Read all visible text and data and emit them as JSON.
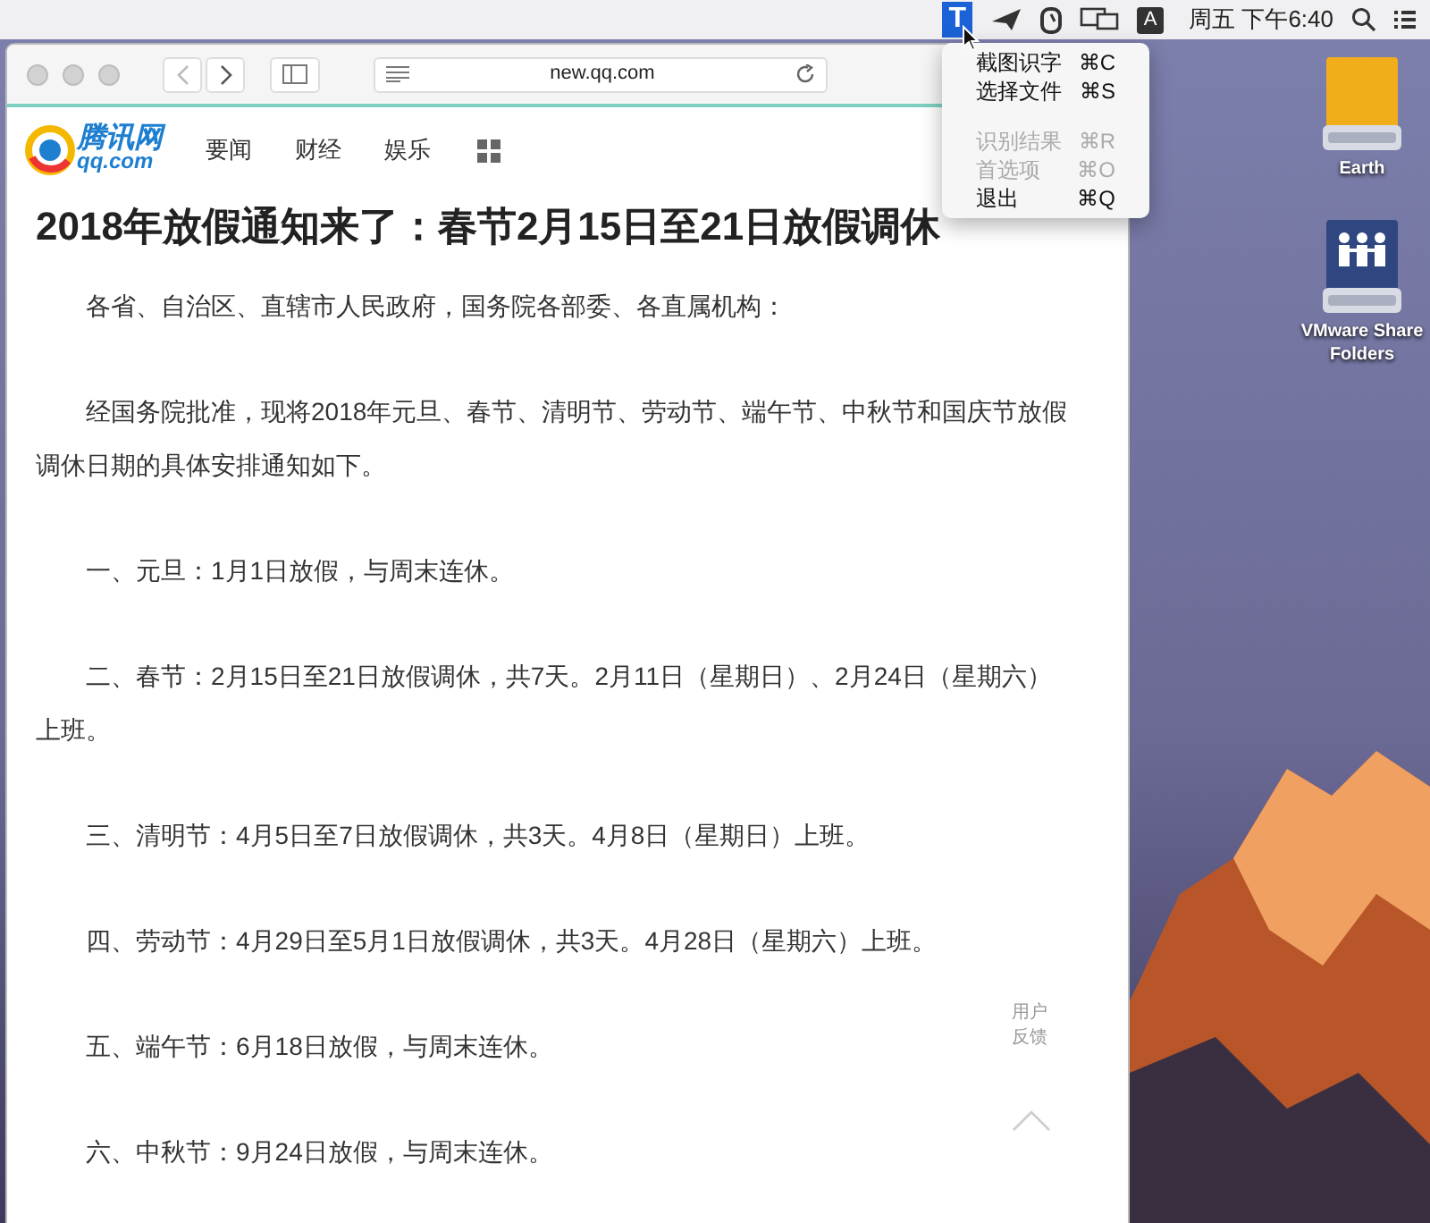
{
  "menu_bar": {
    "clock": "周五 下午6:40",
    "app_icon": {
      "glyph": "T",
      "selected": true
    },
    "input_icon": "A"
  },
  "dropdown_menu": {
    "groups": [
      [
        {
          "label": "截图识字",
          "shortcut": "⌘C",
          "disabled": false
        },
        {
          "label": "选择文件",
          "shortcut": "⌘S",
          "disabled": false
        }
      ],
      [
        {
          "label": "识别结果",
          "shortcut": "⌘R",
          "disabled": true
        },
        {
          "label": "首选项",
          "shortcut": "⌘O",
          "disabled": true
        },
        {
          "label": "退出",
          "shortcut": "⌘Q",
          "disabled": false
        }
      ]
    ]
  },
  "browser": {
    "url": "new.qq.com"
  },
  "site": {
    "logo_text": "腾讯网",
    "logo_domain": "qq.com",
    "nav": [
      "要闻",
      "财经",
      "娱乐"
    ]
  },
  "article": {
    "title": "2018年放假通知来了：春节2月15日至21日放假调休",
    "paragraphs": [
      "各省、自治区、直辖市人民政府，国务院各部委、各直属机构：",
      "经国务院批准，现将2018年元旦、春节、清明节、劳动节、端午节、中秋节和国庆节放假调休日期的具体安排通知如下。",
      "一、元旦：1月1日放假，与周末连休。",
      "二、春节：2月15日至21日放假调休，共7天。2月11日（星期日）、2月24日（星期六）上班。",
      "三、清明节：4月5日至7日放假调休，共3天。4月8日（星期日）上班。",
      "四、劳动节：4月29日至5月1日放假调休，共3天。4月28日（星期六）上班。",
      "五、端午节：6月18日放假，与周末连休。",
      "六、中秋节：9月24日放假，与周末连休。"
    ]
  },
  "feedback": "用户反馈",
  "desktop_icons": [
    {
      "label": "Earth",
      "kind": "drive"
    },
    {
      "label": "VMware Share Folders",
      "kind": "shared"
    }
  ]
}
